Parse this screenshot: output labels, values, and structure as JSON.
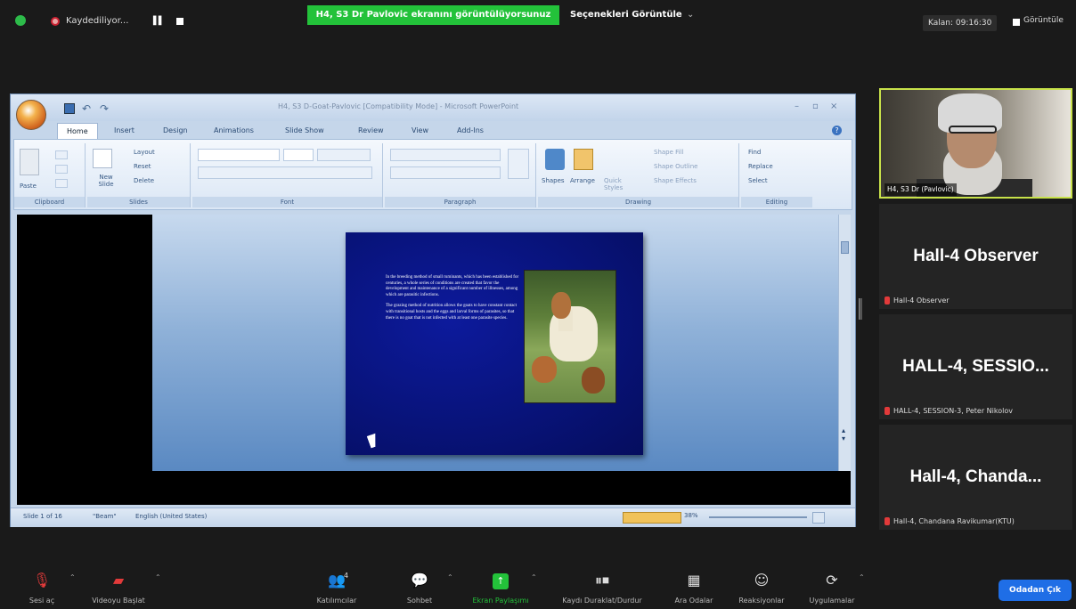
{
  "top_bar": {
    "recording_text": "Kaydediliyor...",
    "share_banner": "H4, S3 Dr Pavlovic ekranını görüntülüyorsunuz",
    "view_options": "Seçenekleri Görüntüle",
    "remaining_time": "Kalan: 09:16:30",
    "view_label": "Görüntüle"
  },
  "powerpoint": {
    "title": "H4, S3 D-Goat-Pavlovic [Compatibility Mode] - Microsoft PowerPoint",
    "tabs": [
      "Home",
      "Insert",
      "Design",
      "Animations",
      "Slide Show",
      "Review",
      "View",
      "Add-Ins"
    ],
    "ribbon": {
      "clipboard": {
        "label": "Clipboard",
        "paste": "Paste"
      },
      "slides": {
        "label": "Slides",
        "new_slide": "New Slide",
        "layout": "Layout",
        "reset": "Reset",
        "delete": "Delete"
      },
      "font": {
        "label": "Font"
      },
      "paragraph": {
        "label": "Paragraph"
      },
      "drawing": {
        "label": "Drawing",
        "shapes": "Shapes",
        "arrange": "Arrange",
        "quick_styles": "Quick Styles",
        "shape_fill": "Shape Fill",
        "shape_outline": "Shape Outline",
        "shape_effects": "Shape Effects"
      },
      "editing": {
        "label": "Editing",
        "find": "Find",
        "replace": "Replace",
        "select": "Select"
      }
    },
    "slide": {
      "paragraph1": "In the breeding method of small ruminants, which has been established for centuries, a whole series of conditions are created that favor the development and maintenance of a significant number of illnesses, among which are parasitic infections.",
      "paragraph2": "The grazing method of nutrition allows the goats to have constant contact with transitional hosts and the eggs and larval forms of parasites, so that there is no goat that is not infected with at least one parasite species."
    },
    "status": {
      "slide_count": "Slide 1 of 16",
      "theme": "\"Beam\"",
      "language": "English (United States)",
      "zoom": "38%"
    }
  },
  "participants": {
    "video_name": "H4, S3 Dr (Pavlovic)",
    "tiles": [
      {
        "big": "Hall-4 Observer",
        "sub": "Hall-4 Observer"
      },
      {
        "big": "HALL-4,  SESSIO...",
        "sub": "HALL-4, SESSION-3, Peter Nikolov"
      },
      {
        "big": "Hall-4,  Chanda...",
        "sub": "Hall-4, Chandana Ravikumar(KTU)"
      }
    ]
  },
  "toolbar": {
    "unmute": "Sesi aç",
    "start_video": "Videoyu Başlat",
    "participants": "Katılımcılar",
    "participants_count": "4",
    "chat": "Sohbet",
    "share_screen": "Ekran Paylaşımı",
    "pause_recording": "Kaydı Duraklat/Durdur",
    "breakout_rooms": "Ara Odalar",
    "reactions": "Reaksiyonlar",
    "apps": "Uygulamalar",
    "leave": "Odadan Çık"
  }
}
